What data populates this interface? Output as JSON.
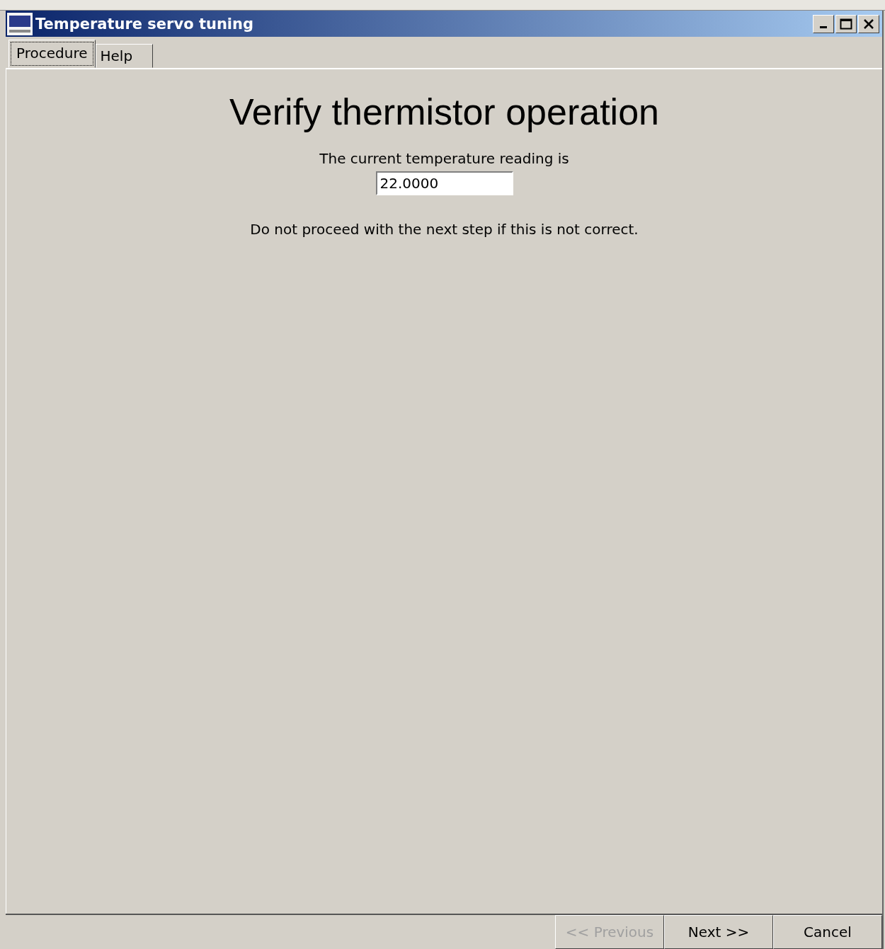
{
  "window": {
    "title": "Temperature servo tuning"
  },
  "tabs": [
    {
      "label": "Procedure",
      "selected": true
    },
    {
      "label": "Help",
      "selected": false
    }
  ],
  "heading": "Verify thermistor operation",
  "reading_label": "The current temperature reading is",
  "reading_field": {
    "value": "22.0000"
  },
  "warning": "Do not proceed with the next step if this is not correct.",
  "buttons": [
    {
      "label": "<< Previous",
      "disabled": true
    },
    {
      "label": "Next >>",
      "disabled": false
    },
    {
      "label": "Cancel",
      "disabled": false
    }
  ]
}
